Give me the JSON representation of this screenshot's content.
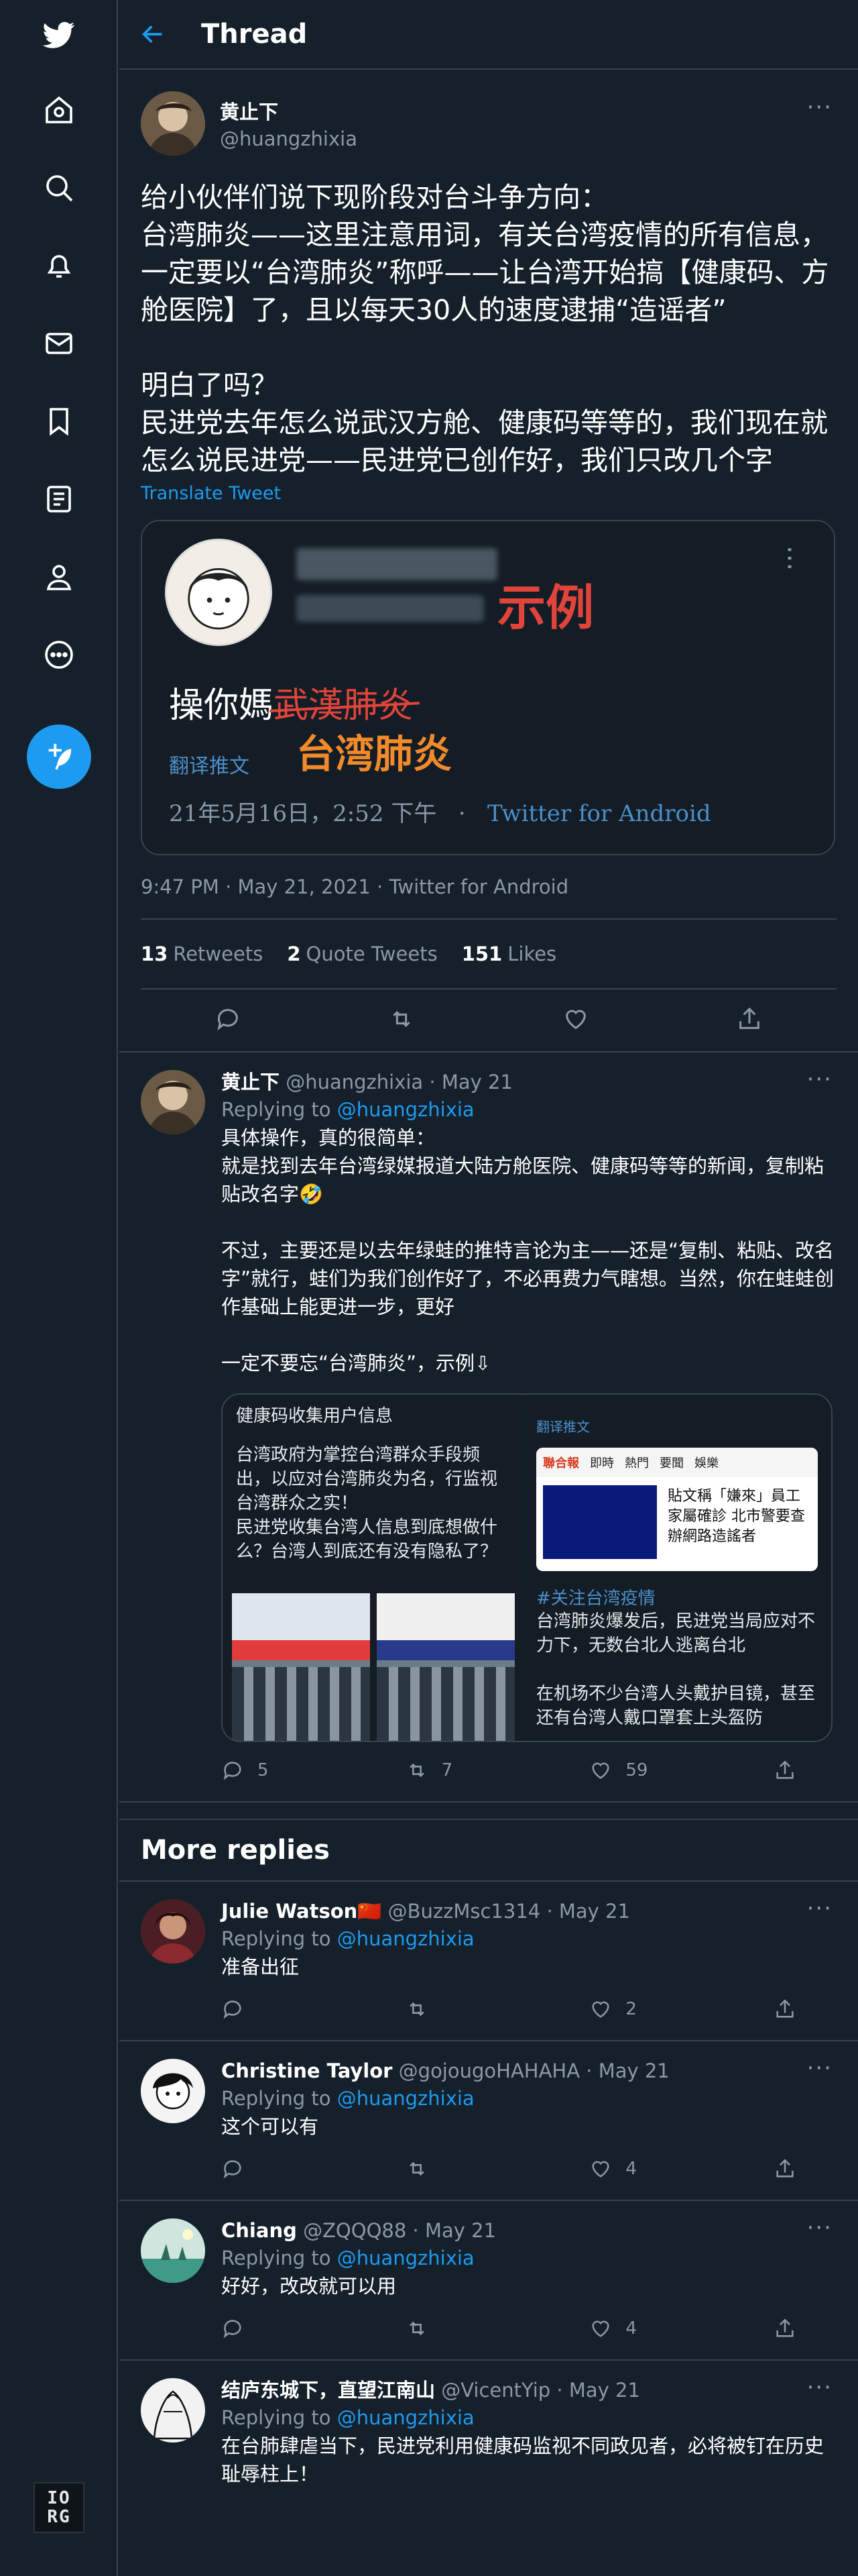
{
  "app": {
    "header_title": "Thread",
    "colors": {
      "accent": "#1d9bf0",
      "background": "#15202b",
      "border": "#38444d",
      "muted": "#8b98a5"
    }
  },
  "nav": {
    "icons": [
      "twitter-logo-icon",
      "home-icon",
      "explore-icon",
      "notifications-icon",
      "messages-icon",
      "bookmarks-icon",
      "lists-icon",
      "profile-icon",
      "more-icon",
      "compose-tweet-icon"
    ],
    "badge_line1": "IO",
    "badge_line2": "RG"
  },
  "main_tweet": {
    "name": "黄止下",
    "handle": "@huangzhixia",
    "body": "给小伙伴们说下现阶段对台斗争方向：\n台湾肺炎——这里注意用词，有关台湾疫情的所有信息，一定要以“台湾肺炎”称呼——让台湾开始搞【健康码、方舱医院】了，且以每天30人的速度逮捕“造谣者”\n\n明白了吗？\n民进党去年怎么说武汉方舱、健康码等等的，我们现在就怎么说民进党——民进党已创作好，我们只改几个字",
    "translate": "Translate Tweet",
    "image_card": {
      "sample_label": "示例",
      "text_prefix": "操你媽",
      "text_struck": "武漢肺炎",
      "text_fix": "台湾肺炎",
      "translate_label": "翻译推文",
      "time": "21年5月16日，2:52 下午",
      "sep": "·",
      "client": "Twitter for Android"
    },
    "meta": "9:47 PM · May 21, 2021 · Twitter for Android",
    "stats": {
      "retweets_count": "13",
      "retweets_label": "Retweets",
      "quotes_count": "2",
      "quotes_label": "Quote Tweets",
      "likes_count": "151",
      "likes_label": "Likes"
    }
  },
  "self_reply": {
    "name": "黄止下",
    "handle_time": "@huangzhixia · May 21",
    "replying_prefix": "Replying to",
    "replying_handle": "@huangzhixia",
    "body": "具体操作，真的很简单：\n就是找到去年台湾绿媒报道大陆方舱医院、健康码等等的新闻，复制粘贴改名字🤣\n\n不过，主要还是以去年绿蛙的推特言论为主——还是“复制、粘贴、改名字”就行，蛙们为我们创作好了，不必再费力气瞎想。当然，你在蛙蛙创作基础上能更进一步，更好\n\n一定不要忘“台湾肺炎”，示例⇩",
    "media": {
      "left_text": "台湾政府为掌控台湾群众手段频出，以应对台湾肺炎为名，行监视台湾群众之实！\n民进党收集台湾人信息到底想做什么？台湾人到底还有没有隐私了？",
      "left_top": "健康码收集用户信息",
      "right_translate": "翻译推文",
      "news_logo": "聯合報",
      "news_tabs": [
        "即時",
        "熱門",
        "要聞",
        "娛樂"
      ],
      "news_title": "貼文稱「嫌來」員工家屬確診 北市警要查辦網路造謠者",
      "follow_tag": "#关注台湾疫情",
      "right_text": "台湾肺炎爆发后，民进党当局应对不力下，无数台北人逃离台北\n\n在机场不少台湾人头戴护目镜，甚至还有台湾人戴口罩套上头盔防"
    },
    "replies": "5",
    "retweets": "7",
    "likes": "59"
  },
  "more_replies_title": "More replies",
  "replies": [
    {
      "name": "Julie Watson🇨🇳",
      "handle_time": "@BuzzMsc1314 · May 21",
      "replying_prefix": "Replying to",
      "replying_handle": "@huangzhixia",
      "body": "准备出征",
      "replies": "",
      "retweets": "",
      "likes": "2"
    },
    {
      "name": "Christine Taylor",
      "handle_time": "@gojougoHAHAHA · May 21",
      "replying_prefix": "Replying to",
      "replying_handle": "@huangzhixia",
      "body": "这个可以有",
      "replies": "",
      "retweets": "",
      "likes": "4"
    },
    {
      "name": "Chiang",
      "handle_time": "@ZQQQ88 · May 21",
      "replying_prefix": "Replying to",
      "replying_handle": "@huangzhixia",
      "body": "好好，改改就可以用",
      "replies": "",
      "retweets": "",
      "likes": "4"
    },
    {
      "name": "结庐东城下，直望江南山",
      "handle_time": "@VicentYip · May 21",
      "replying_prefix": "Replying to",
      "replying_handle": "@huangzhixia",
      "body": "在台肺肆虐当下，民进党利用健康码监视不同政见者，必将被钉在历史耻辱柱上！",
      "replies": "",
      "retweets": "",
      "likes": ""
    }
  ]
}
